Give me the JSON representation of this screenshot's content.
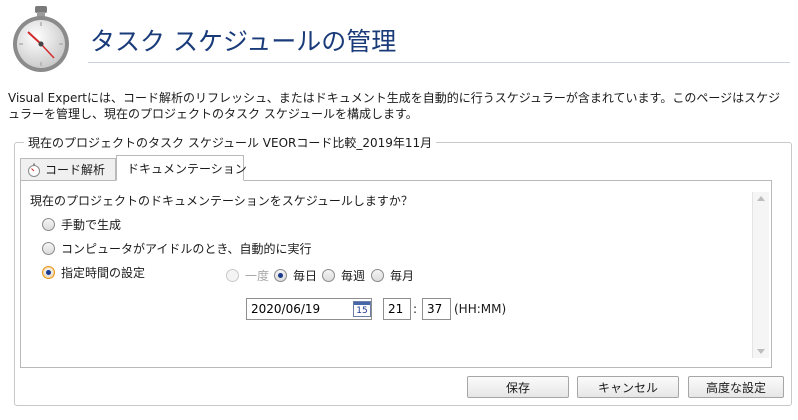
{
  "header": {
    "title": "タスク スケジュールの管理",
    "description": "Visual Expertには、コード解析のリフレッシュ、またはドキュメント生成を自動的に行うスケジュラーが含まれています。このページはスケジュラーを管理し、現在のプロジェクトのタスク スケジュールを構成します。"
  },
  "group": {
    "title": "現在のプロジェクトのタスク スケジュール VEORコード比較_2019年11月"
  },
  "tabs": [
    {
      "label": "コード解析",
      "icon": "stopwatch-icon",
      "active": false
    },
    {
      "label": "ドキュメンテーション",
      "icon": "stopwatch-icon",
      "active": true
    }
  ],
  "schedule": {
    "question": "現在のプロジェクトのドキュメンテーションをスケジュールしますか？",
    "options": [
      {
        "label": "手動で生成",
        "checked": false
      },
      {
        "label": "コンピュータがアイドルのとき、自動的に実行",
        "checked": false
      },
      {
        "label": "指定時間の設定",
        "checked": true
      }
    ],
    "frequency": [
      {
        "label": "一度",
        "checked": false,
        "disabled": true
      },
      {
        "label": "毎日",
        "checked": true,
        "disabled": false
      },
      {
        "label": "毎週",
        "checked": false,
        "disabled": false
      },
      {
        "label": "毎月",
        "checked": false,
        "disabled": false
      }
    ],
    "date": "2020/06/19",
    "calendar_icon_text": "15",
    "hour": "21",
    "minute": "37",
    "time_separator": ":",
    "time_format": "(HH:MM)"
  },
  "buttons": {
    "save": "保存",
    "cancel": "キャンセル",
    "advanced": "高度な設定"
  },
  "colors": {
    "title": "#1a3b7a",
    "accent": "#1b3a8c",
    "selected_radio_border": "#e6941a"
  }
}
